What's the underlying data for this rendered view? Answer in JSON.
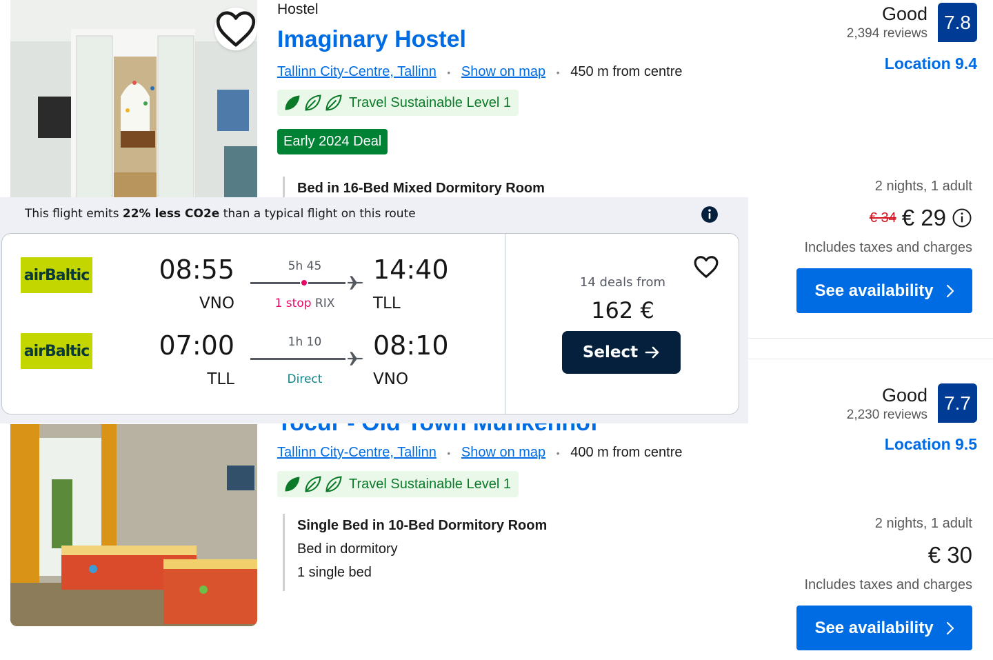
{
  "hotel1": {
    "type": "Hostel",
    "name": "Imaginary Hostel",
    "area_link": "Tallinn City-Centre, Tallinn",
    "map_link": "Show on map",
    "distance": "450 m from centre",
    "sustainable": "Travel Sustainable Level 1",
    "deal": "Early 2024 Deal",
    "room": "Bed in 16-Bed Mixed Dormitory Room",
    "review_word": "Good",
    "review_count": "2,394 reviews",
    "score": "7.8",
    "location_score": "Location 9.4",
    "nights": "2 nights, 1 adult",
    "old_price": "€ 34",
    "price": "€ 29",
    "taxes": "Includes taxes and charges",
    "availability_label": "See availability"
  },
  "hotel2": {
    "name_partial": "Tocur - Old Town Munkenhof",
    "area_link": "Tallinn City-Centre, Tallinn",
    "map_link": "Show on map",
    "distance": "400 m from centre",
    "sustainable": "Travel Sustainable Level 1",
    "room": "Single Bed in 10-Bed Dormitory Room",
    "room_type": "Bed in dormitory",
    "beds": "1 single bed",
    "review_word": "Good",
    "review_count": "2,230 reviews",
    "score": "7.7",
    "location_score": "Location 9.5",
    "nights": "2 nights, 1 adult",
    "price": "€ 30",
    "taxes": "Includes taxes and charges",
    "availability_label": "See availability"
  },
  "flight": {
    "co2_prefix": "This flight emits ",
    "co2_bold": "22% less CO2e",
    "co2_suffix": " than a typical flight on this route",
    "legs": [
      {
        "airline": "airBaltic",
        "depart_time": "08:55",
        "depart_code": "VNO",
        "duration": "5h 45",
        "stops": "1 stop",
        "via": "RIX",
        "arrive_time": "14:40",
        "arrive_code": "TLL"
      },
      {
        "airline": "airBaltic",
        "depart_time": "07:00",
        "depart_code": "TLL",
        "duration": "1h 10",
        "stops": "Direct",
        "arrive_time": "08:10",
        "arrive_code": "VNO"
      }
    ],
    "deals_from": "14 deals from",
    "price": "162 €",
    "select_label": "Select"
  },
  "colors": {
    "booking_blue": "#006ce4",
    "score_navy": "#003b95",
    "deal_green": "#008234",
    "sustainable_green": "#0b7a28",
    "select_navy": "#05203c",
    "airbaltic_green": "#c4d600",
    "stop_pink": "#e70866"
  },
  "icons": [
    "heart-icon",
    "leaf-icon",
    "info-icon",
    "chevron-right-icon",
    "plane-icon",
    "arrow-right-icon"
  ]
}
